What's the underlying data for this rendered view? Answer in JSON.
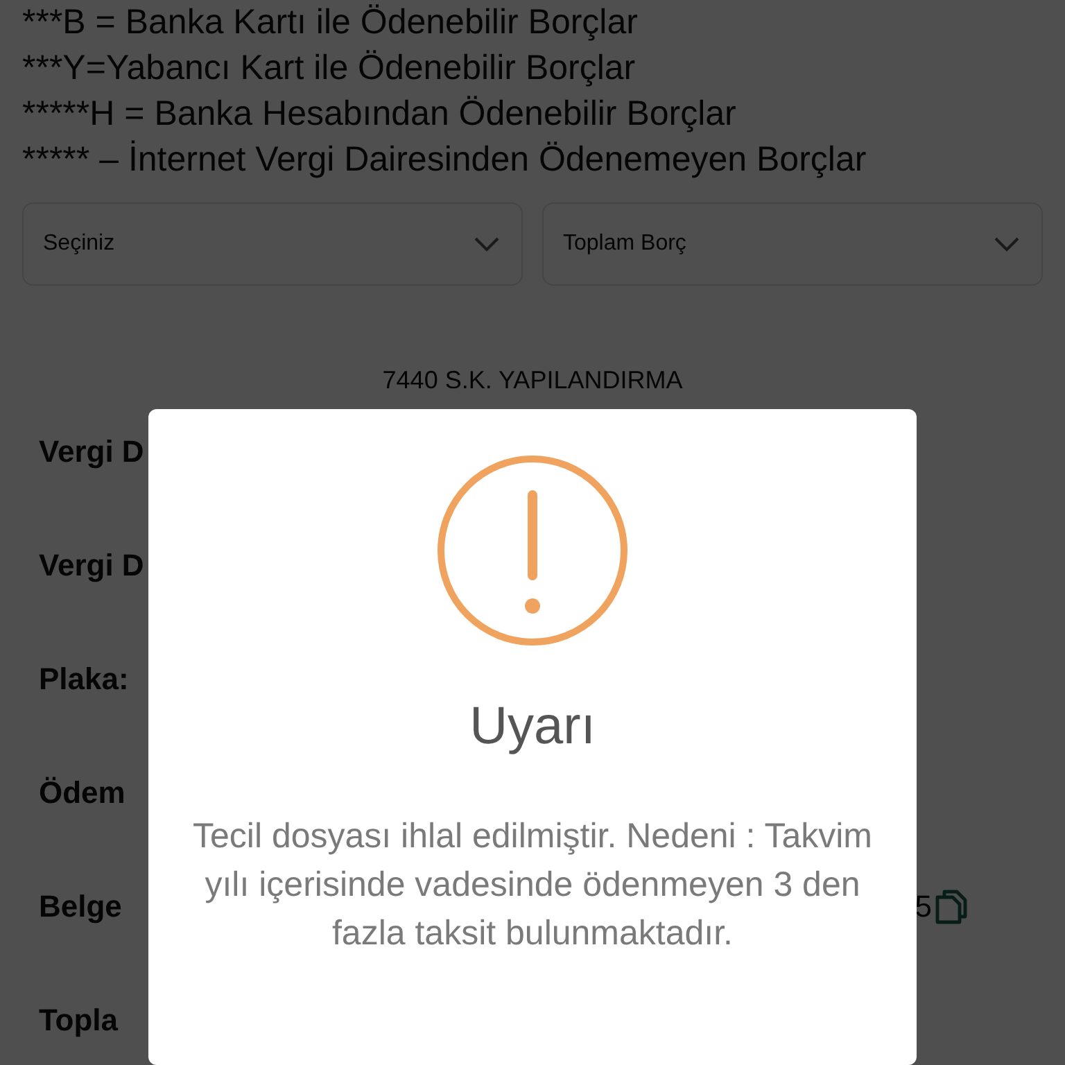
{
  "legend": [
    "***B = Banka Kartı ile Ödenebilir Borçlar",
    "***Y=Yabancı Kart ile Ödenebilir Borçlar",
    "*****H = Banka Hesabından Ödenebilir Borçlar",
    "***** – İnternet Vergi Dairesinden Ödenemeyen Borçlar"
  ],
  "selects": [
    {
      "placeholder": "Seçiniz"
    },
    {
      "placeholder": "Toplam Borç"
    }
  ],
  "section_title": "7440 S.K. YAPILANDIRMA",
  "rows": [
    {
      "label": "Vergi D"
    },
    {
      "label": "Vergi D"
    },
    {
      "label": "Plaka:"
    },
    {
      "label": "Ödem"
    },
    {
      "label": "Belge",
      "value": "5",
      "copyable": true
    },
    {
      "label": "Topla"
    }
  ],
  "modal": {
    "kind": "warning",
    "title": "Uyarı",
    "message": "Tecil dosyası ihlal edilmiştir. Nedeni : Takvim yılı içerisinde vadesinde ödenmeyen 3 den fazla taksit bulunmaktadır."
  }
}
